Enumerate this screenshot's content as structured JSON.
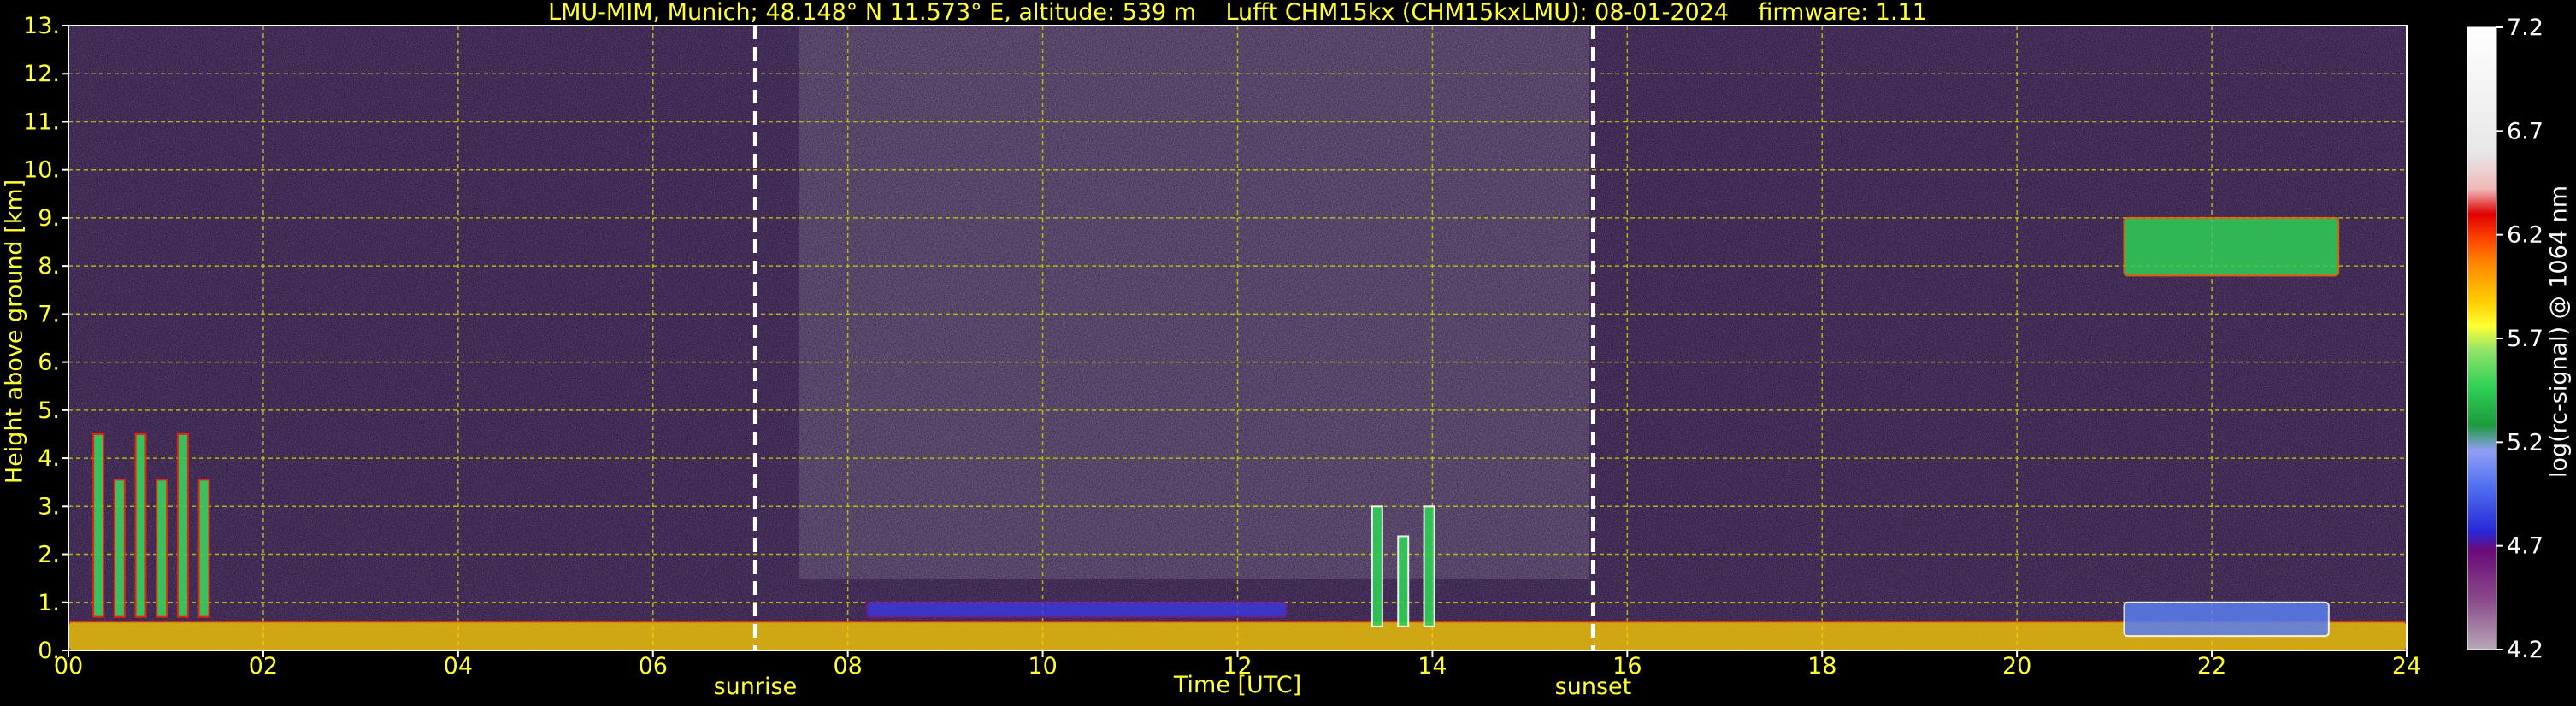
{
  "header": {
    "title": "LMU-MIM, Munich; 48.148° N 11.573° E, altitude: 539 m    Lufft CHM15kx (CHM15kxLMU): 08-01-2024    firmware: 1.11"
  },
  "chart_data": {
    "type": "heatmap",
    "xlabel": "Time [UTC]",
    "ylabel": "Height above ground [km]",
    "xlim": [
      0,
      24
    ],
    "ylim": [
      0,
      13
    ],
    "xticks": [
      "00",
      "02",
      "04",
      "06",
      "08",
      "10",
      "12",
      "14",
      "16",
      "18",
      "20",
      "22",
      "24"
    ],
    "yticks": [
      "0.",
      "1.",
      "2.",
      "3.",
      "4.",
      "5.",
      "6.",
      "7.",
      "8.",
      "9.",
      "10.",
      "11.",
      "12.",
      "13."
    ],
    "grid": true,
    "events": [
      {
        "label": "sunrise",
        "time": 7.05
      },
      {
        "label": "sunset",
        "time": 15.65
      }
    ],
    "colorbar": {
      "label": "log(rc-signal) @ 1064 nm",
      "range": [
        4.2,
        7.2
      ],
      "ticks": [
        "4.2",
        "4.7",
        "5.2",
        "5.7",
        "6.2",
        "6.7",
        "7.2"
      ]
    },
    "features": [
      {
        "description": "aerosol layer near ground",
        "time_range": [
          0,
          24
        ],
        "height_km": [
          0,
          0.6
        ]
      },
      {
        "description": "convective cloud columns",
        "time_range": [
          0.2,
          1.5
        ],
        "height_km": [
          0.7,
          4.5
        ]
      },
      {
        "description": "residual layer",
        "time_range": [
          8.2,
          12.5
        ],
        "height_km": [
          0.7,
          1.0
        ]
      },
      {
        "description": "low clouds",
        "time_range": [
          13.3,
          14.1
        ],
        "height_km": [
          0.5,
          3.0
        ]
      },
      {
        "description": "cirrus cloud",
        "time_range": [
          21.1,
          23.3
        ],
        "height_km": [
          7.8,
          9.0
        ]
      },
      {
        "description": "aerosol layer",
        "time_range": [
          21.1,
          23.2
        ],
        "height_km": [
          0.3,
          1.0
        ]
      }
    ]
  }
}
